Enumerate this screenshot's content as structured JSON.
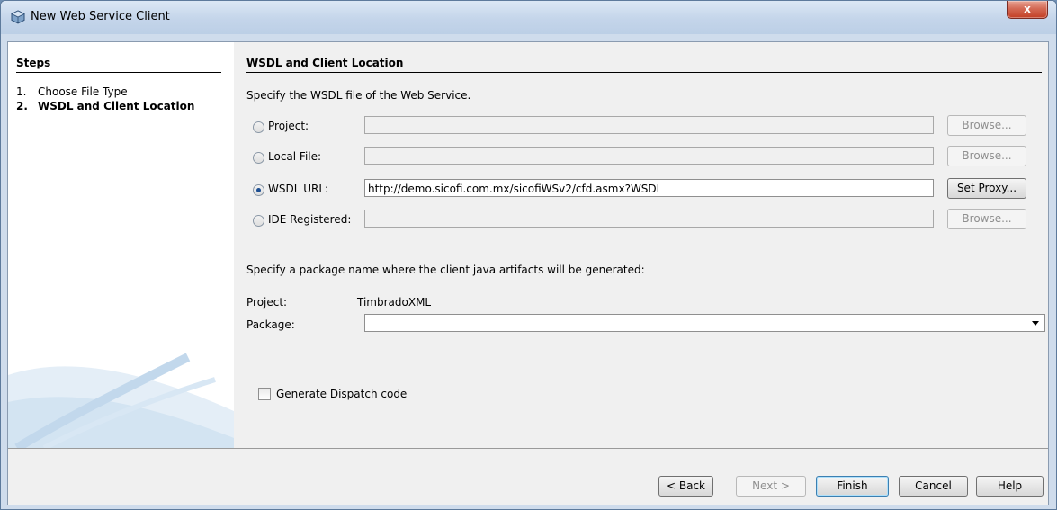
{
  "window": {
    "title": "New Web Service Client",
    "close_label": "x"
  },
  "steps": {
    "heading": "Steps",
    "items": [
      {
        "num": "1.",
        "label": "Choose File Type"
      },
      {
        "num": "2.",
        "label": "WSDL and Client Location"
      }
    ]
  },
  "content": {
    "heading": "WSDL and Client Location",
    "instruction": "Specify the WSDL file of the Web Service.",
    "sources": [
      {
        "label": "Project:",
        "value": "",
        "button": "Browse...",
        "selected": false
      },
      {
        "label": "Local File:",
        "value": "",
        "button": "Browse...",
        "selected": false
      },
      {
        "label": "WSDL URL:",
        "value": "http://demo.sicofi.com.mx/sicofiWSv2/cfd.asmx?WSDL",
        "button": "Set Proxy...",
        "selected": true
      },
      {
        "label": "IDE Registered:",
        "value": "",
        "button": "Browse...",
        "selected": false
      }
    ],
    "package_instruction": "Specify a package name where the client java artifacts will be generated:",
    "project_label": "Project:",
    "project_value": "TimbradoXML",
    "package_label": "Package:",
    "package_value": "",
    "dispatch_label": "Generate Dispatch code"
  },
  "footer": {
    "back": "< Back",
    "next": "Next >",
    "finish": "Finish",
    "cancel": "Cancel",
    "help": "Help"
  }
}
